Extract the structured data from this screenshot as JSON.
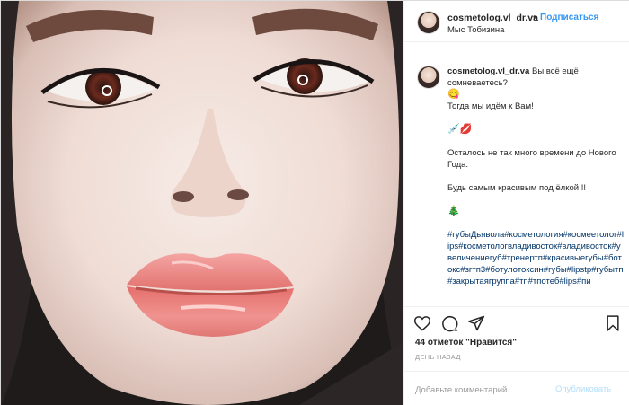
{
  "header": {
    "username": "cosmetolog.vl_dr.va",
    "separator": "•",
    "follow_label": "Подписаться",
    "location": "Мыс Тобизина"
  },
  "caption": {
    "username": "cosmetolog.vl_dr.va",
    "line1": "Вы всё ещё сомневаетесь?",
    "emoji1": "😋",
    "line2": "Тогда мы идём к Вам!",
    "emoji2": "💉💋",
    "line3": "Осталось не так много времени до Нового Года.",
    "line4": "Будь самым красивым под ёлкой!!!",
    "emoji3": "🎄",
    "hashtags": "#губыДьявола#косметология#космеетолог#lips#косметологвладивосток#владивосток#увеличениегуб#тренертп#красивыегубы#ботокс#згтп3#ботулотоксин#губы#lipstp#губытп#закрытаягруппа#тп#тпотеб#lips#пи"
  },
  "actions": {
    "like_icon": "heart-icon",
    "comment_icon": "comment-icon",
    "share_icon": "share-icon",
    "save_icon": "bookmark-icon"
  },
  "likes_text": "44 отметок \"Нравится\"",
  "time_text": "ДЕНЬ НАЗАД",
  "comment_form": {
    "placeholder": "Добавьте комментарий...",
    "publish_label": "Опубликовать"
  },
  "colors": {
    "accent": "#3897f0",
    "hashtag": "#003569",
    "muted": "#999999",
    "publish_disabled": "#b2dffc"
  }
}
